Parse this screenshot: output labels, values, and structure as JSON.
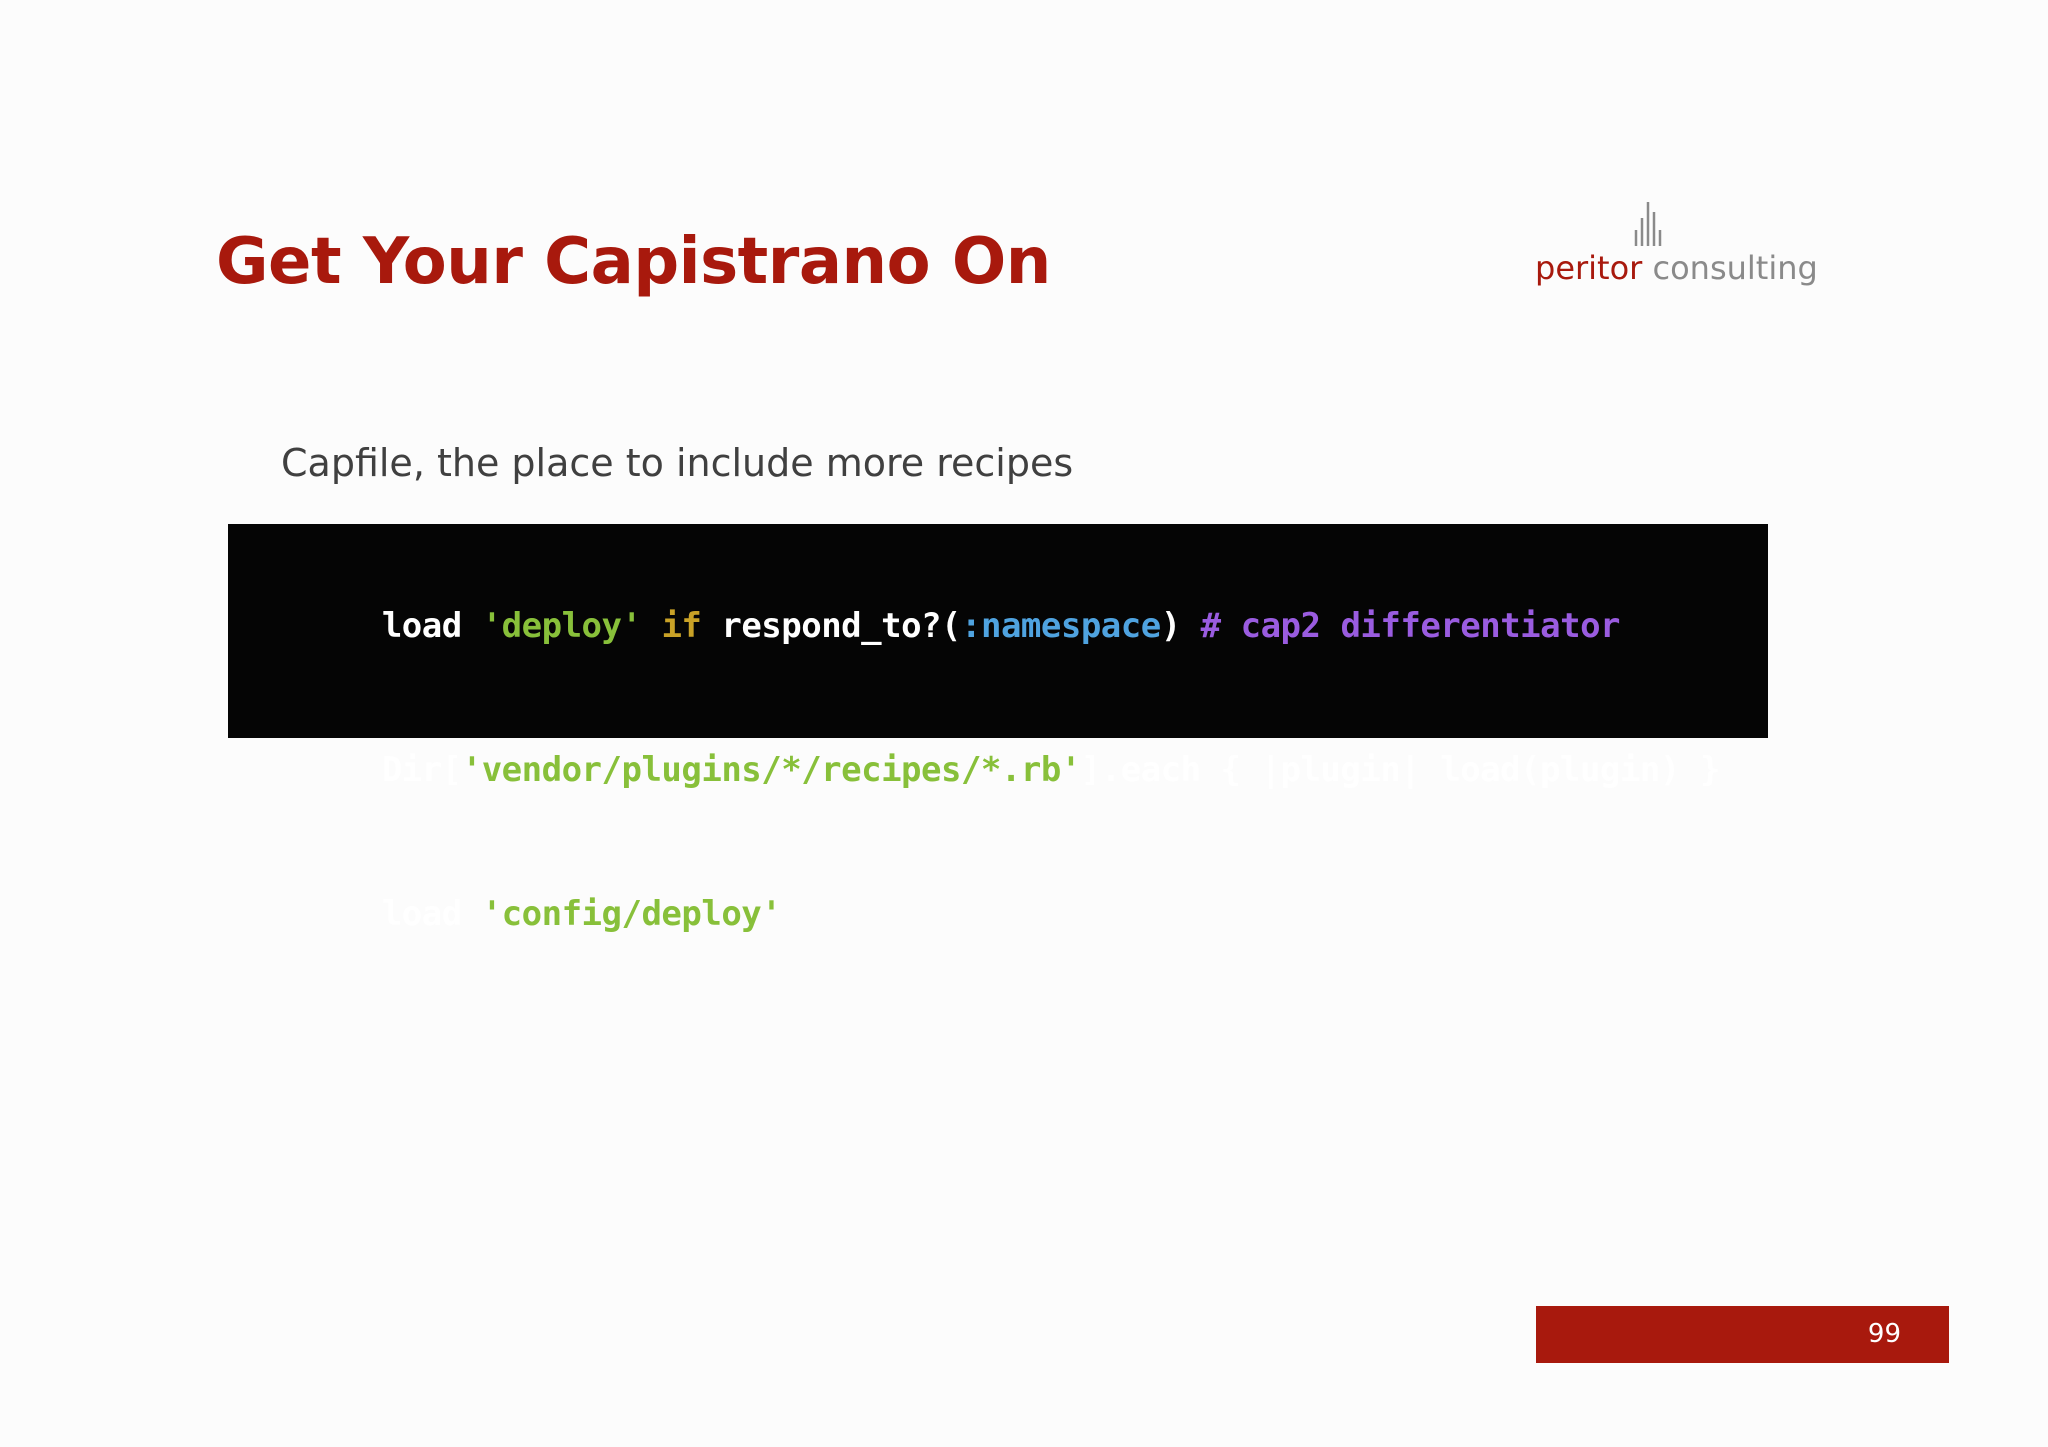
{
  "slide": {
    "title": "Get Your Capistrano On",
    "subtitle": "Capfile, the place to include more recipes",
    "page_number": "99"
  },
  "logo": {
    "word1": "peritor",
    "word2": "consulting",
    "icon": "bar-lines-logo-icon"
  },
  "colors": {
    "accent": "#a8190d",
    "code_background": "#050505",
    "code_string": "#88c03a",
    "code_keyword": "#c9a227",
    "code_symbol": "#4fa3e0",
    "code_comment": "#9a5ce0"
  },
  "code": {
    "lines": [
      [
        {
          "type": "plain",
          "text": "load "
        },
        {
          "type": "string",
          "text": "'deploy'"
        },
        {
          "type": "plain",
          "text": " "
        },
        {
          "type": "keyword",
          "text": "if"
        },
        {
          "type": "plain",
          "text": " respond_to?("
        },
        {
          "type": "symbol",
          "text": ":namespace"
        },
        {
          "type": "plain",
          "text": ") "
        },
        {
          "type": "comment",
          "text": "# cap2 differentiator"
        }
      ],
      [
        {
          "type": "plain",
          "text": "Dir["
        },
        {
          "type": "string",
          "text": "'vendor/plugins/*/recipes/*.rb'"
        },
        {
          "type": "plain",
          "text": "].each { |plugin| load(plugin) }"
        }
      ],
      [
        {
          "type": "plain",
          "text": "load "
        },
        {
          "type": "string",
          "text": "'config/deploy'"
        }
      ]
    ]
  }
}
